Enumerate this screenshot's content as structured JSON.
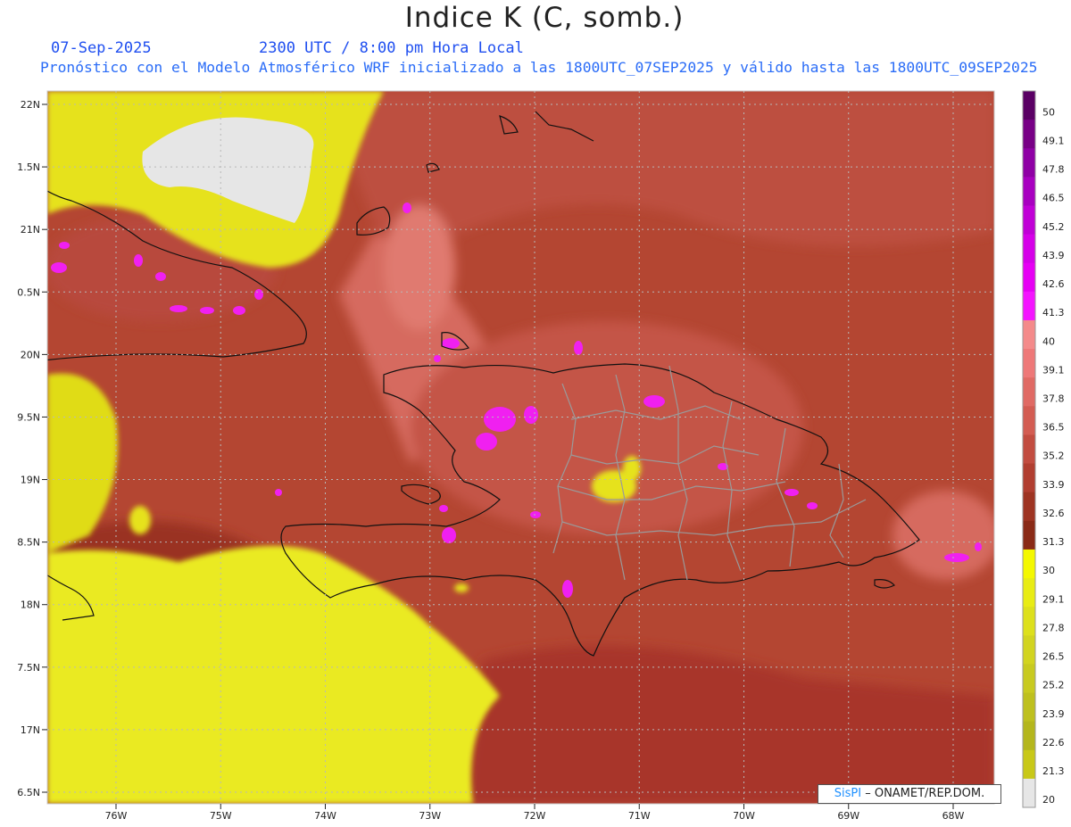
{
  "title": "Indice K (C, somb.)",
  "date": "07-Sep-2025",
  "time": "2300 UTC / 8:00 pm Hora Local",
  "forecast": "Pronóstico con el Modelo Atmosférico WRF inicializado a las 1800UTC_07SEP2025 y válido hasta las  1800UTC_09SEP2025",
  "credit": {
    "brand": "SisPI",
    "rest": "– ONAMET/REP.DOM."
  },
  "lat_labels": [
    "22N",
    "1.5N",
    "21N",
    "0.5N",
    "20N",
    "9.5N",
    "19N",
    "8.5N",
    "18N",
    "7.5N",
    "17N",
    "6.5N"
  ],
  "lat_values": [
    22,
    21.5,
    21,
    20.5,
    20,
    19.5,
    19,
    18.5,
    18,
    17.5,
    17,
    16.5
  ],
  "lon_labels": [
    "76W",
    "75W",
    "74W",
    "73W",
    "72W",
    "71W",
    "70W",
    "69W",
    "68W"
  ],
  "lon_values": [
    -76,
    -75,
    -74,
    -73,
    -72,
    -71,
    -70,
    -69,
    -68
  ],
  "colorbar_labels": [
    "50",
    "49.1",
    "47.8",
    "46.5",
    "45.2",
    "43.9",
    "42.6",
    "41.3",
    "40",
    "39.1",
    "37.8",
    "36.5",
    "35.2",
    "33.9",
    "32.6",
    "31.3",
    "30",
    "29.1",
    "27.8",
    "26.5",
    "25.2",
    "23.9",
    "22.6",
    "21.3",
    "20"
  ],
  "colorbar_colors": [
    "#5a0064",
    "#780086",
    "#8f00a5",
    "#a800c0",
    "#c000d6",
    "#d500e8",
    "#e600f4",
    "#f414ff",
    "#f48a8a",
    "#ee7878",
    "#e06a64",
    "#d35c52",
    "#c24c40",
    "#b13e30",
    "#9e3422",
    "#8a2a16",
    "#f4f800",
    "#e8ec14",
    "#dde01c",
    "#d2d420",
    "#c8ca20",
    "#bec01e",
    "#b4b61c",
    "#c8c818",
    "#e6e6e6"
  ],
  "colors": {
    "land_border": "#111111",
    "province_border": "#9a9a9a",
    "grid": "#b8b8b8",
    "background_sea": "#a83a28"
  }
}
